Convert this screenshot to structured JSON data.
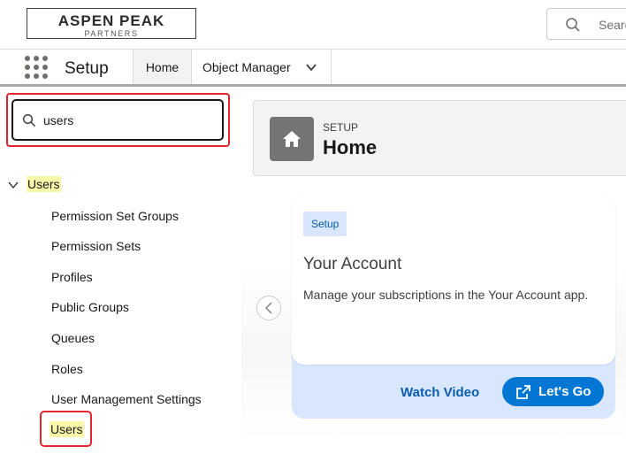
{
  "header": {
    "logo_main": "ASPEN PEAK",
    "logo_sub": "PARTNERS",
    "search_placeholder": "Search"
  },
  "nav": {
    "app_name": "Setup",
    "tabs": [
      {
        "label": "Home",
        "active": true
      },
      {
        "label": "Object Manager",
        "has_dropdown": true
      }
    ]
  },
  "sidebar": {
    "quick_find_value": "users",
    "tree": {
      "root_label": "Users",
      "expanded": true,
      "items": [
        {
          "label": "Permission Set Groups"
        },
        {
          "label": "Permission Sets"
        },
        {
          "label": "Profiles"
        },
        {
          "label": "Public Groups"
        },
        {
          "label": "Queues"
        },
        {
          "label": "Roles"
        },
        {
          "label": "User Management Settings"
        },
        {
          "label": "Users",
          "highlighted": true
        }
      ]
    }
  },
  "main": {
    "page_header": {
      "eyebrow": "SETUP",
      "title": "Home",
      "icon": "home-icon"
    },
    "card": {
      "badge": "Setup",
      "title": "Your Account",
      "description": "Manage your subscriptions in the Your Account app.",
      "watch_video_label": "Watch Video",
      "lets_go_label": "Let's Go"
    }
  },
  "colors": {
    "highlight_border": "#e3262d",
    "search_highlight": "#fbf7a9",
    "brand_blue": "#0176d3",
    "card_footer": "#d8e6fe"
  }
}
